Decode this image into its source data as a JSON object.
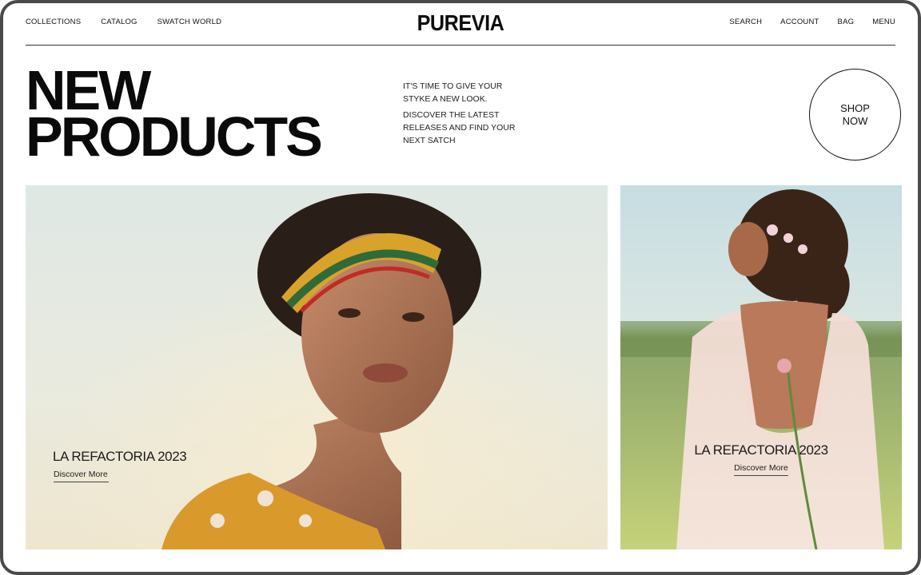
{
  "nav": {
    "left": [
      "COLLECTIONS",
      "CATALOG",
      "SWATCH WORLD"
    ],
    "right": [
      "SEARCH",
      "ACCOUNT",
      "BAG",
      "MENU"
    ],
    "logo": "PUREVIA"
  },
  "hero": {
    "title_line1": "NEW",
    "title_line2": "PRODUCTS",
    "copy_1": "IT'S TIME TO GIVE YOUR STYKE A NEW LOOK.",
    "copy_2": "DISCOVER THE LATEST RELEASES AND FIND YOUR NEXT SATCH",
    "cta": "SHOP NOW"
  },
  "cards": [
    {
      "title": "LA REFACTORIA 2023",
      "link": "Discover More"
    },
    {
      "title": "LA REFACTORIA 2023",
      "link": "Discover More"
    }
  ],
  "colors": {
    "text": "#111111",
    "frame": "#4a4a4a"
  },
  "icons": []
}
